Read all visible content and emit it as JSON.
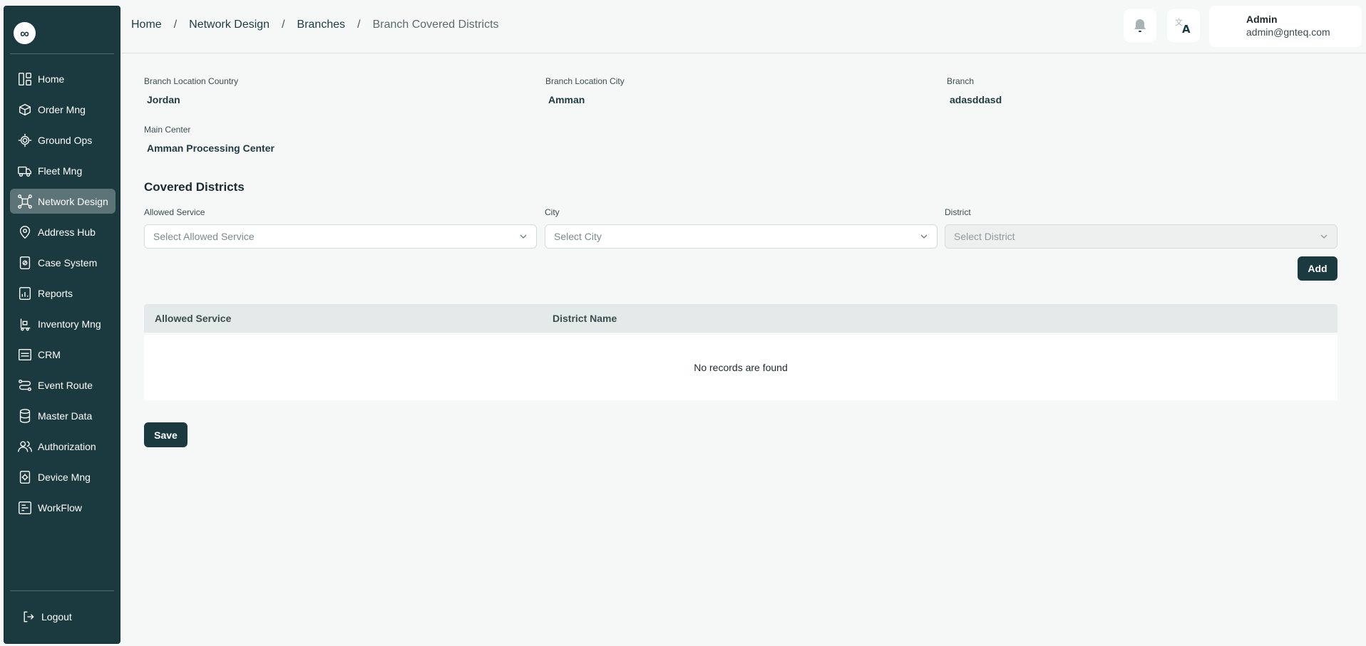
{
  "app": {
    "logo_symbol": "∞"
  },
  "sidebar": {
    "items": [
      {
        "label": "Home",
        "icon": "dashboard-icon"
      },
      {
        "label": "Order Mng",
        "icon": "order-box-icon"
      },
      {
        "label": "Ground Ops",
        "icon": "ground-ops-icon"
      },
      {
        "label": "Fleet Mng",
        "icon": "truck-icon"
      },
      {
        "label": "Network Design",
        "icon": "network-icon"
      },
      {
        "label": "Address Hub",
        "icon": "map-pin-icon"
      },
      {
        "label": "Case System",
        "icon": "case-file-icon"
      },
      {
        "label": "Reports",
        "icon": "report-chart-icon"
      },
      {
        "label": "Inventory Mng",
        "icon": "forklift-icon"
      },
      {
        "label": "CRM",
        "icon": "crm-icon"
      },
      {
        "label": "Event Route",
        "icon": "route-icon"
      },
      {
        "label": "Master Data",
        "icon": "database-icon"
      },
      {
        "label": "Authorization",
        "icon": "users-icon"
      },
      {
        "label": "Device Mng",
        "icon": "device-gear-icon"
      },
      {
        "label": "WorkFlow",
        "icon": "workflow-icon"
      }
    ],
    "active": "Network Design",
    "logout_label": "Logout"
  },
  "breadcrumb": {
    "items": [
      "Home",
      "Network Design",
      "Branches"
    ],
    "current": "Branch Covered Districts",
    "separator": "/"
  },
  "header": {
    "notification_icon": "bell-icon",
    "language_icon": "translate-icon",
    "user_name": "Admin",
    "user_email": "admin@gnteq.com"
  },
  "branch_info": {
    "country_label": "Branch Location Country",
    "country_value": "Jordan",
    "city_label": "Branch Location City",
    "city_value": "Amman",
    "branch_label": "Branch",
    "branch_value": "adasddasd",
    "main_center_label": "Main Center",
    "main_center_value": "Amman Processing Center"
  },
  "covered_districts": {
    "title": "Covered Districts",
    "allowed_service_label": "Allowed Service",
    "allowed_service_placeholder": "Select Allowed Service",
    "city_label": "City",
    "city_placeholder": "Select City",
    "district_label": "District",
    "district_placeholder": "Select District",
    "add_label": "Add"
  },
  "table": {
    "columns": [
      "Allowed Service",
      "District Name"
    ],
    "empty_text": "No records are found"
  },
  "save_label": "Save",
  "colors": {
    "primary": "#1b3a3f",
    "active_nav": "#5c7377",
    "background": "#f6f8f7"
  }
}
